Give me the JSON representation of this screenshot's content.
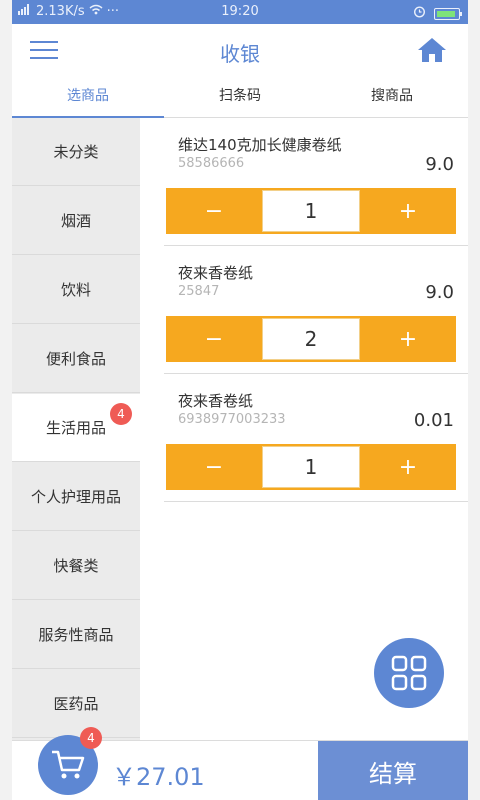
{
  "status_bar": {
    "network": "2.13K/s",
    "dots": "···",
    "time": "19:20"
  },
  "header": {
    "title": "收银"
  },
  "tabs": [
    {
      "label": "选商品",
      "active": true
    },
    {
      "label": "扫条码",
      "active": false
    },
    {
      "label": "搜商品",
      "active": false
    }
  ],
  "categories": [
    {
      "label": "未分类"
    },
    {
      "label": "烟酒"
    },
    {
      "label": "饮料"
    },
    {
      "label": "便利食品"
    },
    {
      "label": "生活用品",
      "active": true,
      "badge": "4"
    },
    {
      "label": "个人护理用品"
    },
    {
      "label": "快餐类"
    },
    {
      "label": "服务性商品"
    },
    {
      "label": "医药品"
    }
  ],
  "products": [
    {
      "name": "维达140克加长健康卷纸",
      "code": "58586666",
      "price": "9.0",
      "qty": "1"
    },
    {
      "name": "夜来香卷纸",
      "code": "25847",
      "price": "9.0",
      "qty": "2"
    },
    {
      "name": "夜来香卷纸",
      "code": "6938977003233",
      "price": "0.01",
      "qty": "1"
    }
  ],
  "stepper": {
    "minus": "−",
    "plus": "+"
  },
  "bottom": {
    "cart_badge": "4",
    "total": "￥27.01",
    "checkout_label": "结算"
  },
  "colors": {
    "primary": "#5d87d3",
    "stepper": "#f6a81f",
    "badge": "#ef5b55"
  }
}
